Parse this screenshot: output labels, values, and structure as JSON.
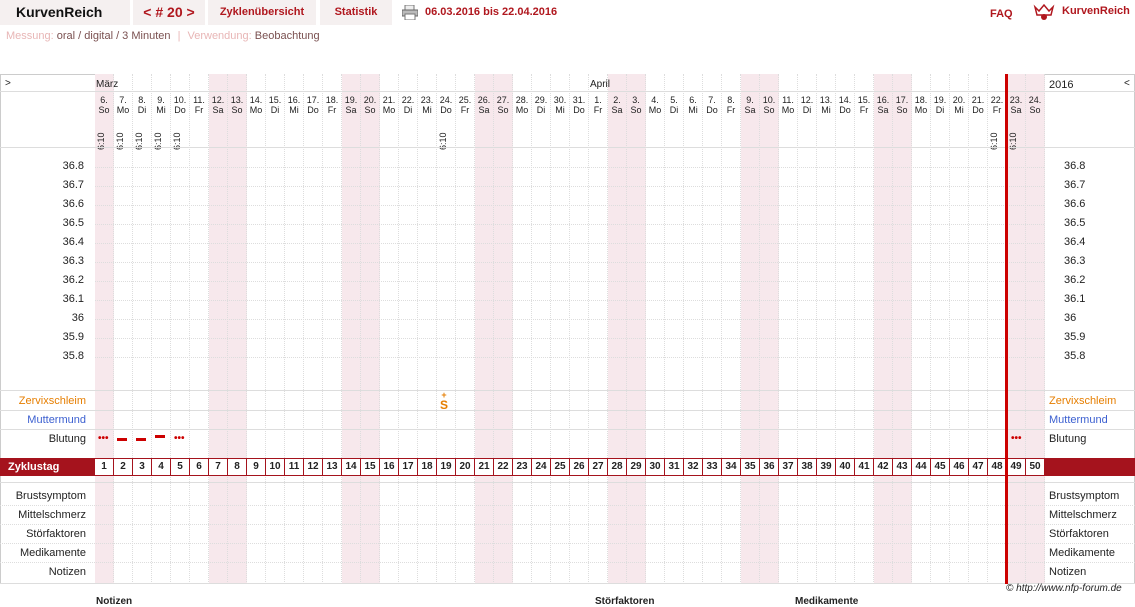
{
  "topbar": {
    "brand": "KurvenReich",
    "cycle": "< # 20 >",
    "tabs": [
      "Zyklenübersicht",
      "Statistik"
    ],
    "date_range": "06.03.2016 bis 22.04.2016",
    "faq": "FAQ",
    "logo_text": "KurvenReich"
  },
  "meta": {
    "messung_label": "Messung:",
    "messung_value": "oral / digital / 3 Minuten",
    "verwendung_label": "Verwendung:",
    "verwendung_value": "Beobachtung"
  },
  "chart_header": {
    "arrow_left": ">",
    "arrow_right": "<",
    "month_1": "März",
    "month_2": "April",
    "year": "2016"
  },
  "days": [
    {
      "num": "6.",
      "wd": "So",
      "time": "6:10"
    },
    {
      "num": "7.",
      "wd": "Mo",
      "time": "6:10"
    },
    {
      "num": "8.",
      "wd": "Di",
      "time": "6:10"
    },
    {
      "num": "9.",
      "wd": "Mi",
      "time": "6:10"
    },
    {
      "num": "10.",
      "wd": "Do",
      "time": "6:10"
    },
    {
      "num": "11.",
      "wd": "Fr",
      "time": ""
    },
    {
      "num": "12.",
      "wd": "Sa",
      "time": ""
    },
    {
      "num": "13.",
      "wd": "So",
      "time": ""
    },
    {
      "num": "14.",
      "wd": "Mo",
      "time": ""
    },
    {
      "num": "15.",
      "wd": "Di",
      "time": ""
    },
    {
      "num": "16.",
      "wd": "Mi",
      "time": ""
    },
    {
      "num": "17.",
      "wd": "Do",
      "time": ""
    },
    {
      "num": "18.",
      "wd": "Fr",
      "time": ""
    },
    {
      "num": "19.",
      "wd": "Sa",
      "time": ""
    },
    {
      "num": "20.",
      "wd": "So",
      "time": ""
    },
    {
      "num": "21.",
      "wd": "Mo",
      "time": ""
    },
    {
      "num": "22.",
      "wd": "Di",
      "time": ""
    },
    {
      "num": "23.",
      "wd": "Mi",
      "time": ""
    },
    {
      "num": "24.",
      "wd": "Do",
      "time": "6:10"
    },
    {
      "num": "25.",
      "wd": "Fr",
      "time": ""
    },
    {
      "num": "26.",
      "wd": "Sa",
      "time": ""
    },
    {
      "num": "27.",
      "wd": "So",
      "time": ""
    },
    {
      "num": "28.",
      "wd": "Mo",
      "time": ""
    },
    {
      "num": "29.",
      "wd": "Di",
      "time": ""
    },
    {
      "num": "30.",
      "wd": "Mi",
      "time": ""
    },
    {
      "num": "31.",
      "wd": "Do",
      "time": ""
    },
    {
      "num": "1.",
      "wd": "Fr",
      "time": ""
    },
    {
      "num": "2.",
      "wd": "Sa",
      "time": ""
    },
    {
      "num": "3.",
      "wd": "So",
      "time": ""
    },
    {
      "num": "4.",
      "wd": "Mo",
      "time": ""
    },
    {
      "num": "5.",
      "wd": "Di",
      "time": ""
    },
    {
      "num": "6.",
      "wd": "Mi",
      "time": ""
    },
    {
      "num": "7.",
      "wd": "Do",
      "time": ""
    },
    {
      "num": "8.",
      "wd": "Fr",
      "time": ""
    },
    {
      "num": "9.",
      "wd": "Sa",
      "time": ""
    },
    {
      "num": "10.",
      "wd": "So",
      "time": ""
    },
    {
      "num": "11.",
      "wd": "Mo",
      "time": ""
    },
    {
      "num": "12.",
      "wd": "Di",
      "time": ""
    },
    {
      "num": "13.",
      "wd": "Mi",
      "time": ""
    },
    {
      "num": "14.",
      "wd": "Do",
      "time": ""
    },
    {
      "num": "15.",
      "wd": "Fr",
      "time": ""
    },
    {
      "num": "16.",
      "wd": "Sa",
      "time": ""
    },
    {
      "num": "17.",
      "wd": "So",
      "time": ""
    },
    {
      "num": "18.",
      "wd": "Mo",
      "time": ""
    },
    {
      "num": "19.",
      "wd": "Di",
      "time": ""
    },
    {
      "num": "20.",
      "wd": "Mi",
      "time": ""
    },
    {
      "num": "21.",
      "wd": "Do",
      "time": ""
    },
    {
      "num": "22.",
      "wd": "Fr",
      "time": "6:10"
    },
    {
      "num": "23.",
      "wd": "Sa",
      "time": "6:10"
    },
    {
      "num": "24.",
      "wd": "So",
      "time": ""
    }
  ],
  "temperatures": [
    "36.8",
    "36.7",
    "36.6",
    "36.5",
    "36.4",
    "36.3",
    "36.2",
    "36.1",
    "36",
    "35.9",
    "35.8"
  ],
  "rows": {
    "zervix": "Zervixschleim",
    "muttermund": "Muttermund",
    "blutung": "Blutung",
    "zyklustag": "Zyklustag",
    "brust": "Brustsymptom",
    "mittel": "Mittelschmerz",
    "stoer": "Störfaktoren",
    "medi": "Medikamente",
    "notizen": "Notizen"
  },
  "bleeding_marks": [
    "•••",
    "▬",
    "▬",
    "▬",
    "•••",
    "•••"
  ],
  "zervix_mark": "S",
  "copyright": "© http://www.nfp-forum.de",
  "below": {
    "notizen": "Notizen",
    "stoerfaktoren": "Störfaktoren",
    "medikamente": "Medikamente"
  },
  "colors": {
    "accent": "#b0171e",
    "zyklustag_bar": "#a5131d",
    "weekend": "#f7e8ec"
  },
  "icons": [
    "printer-icon",
    "logo-icon"
  ]
}
